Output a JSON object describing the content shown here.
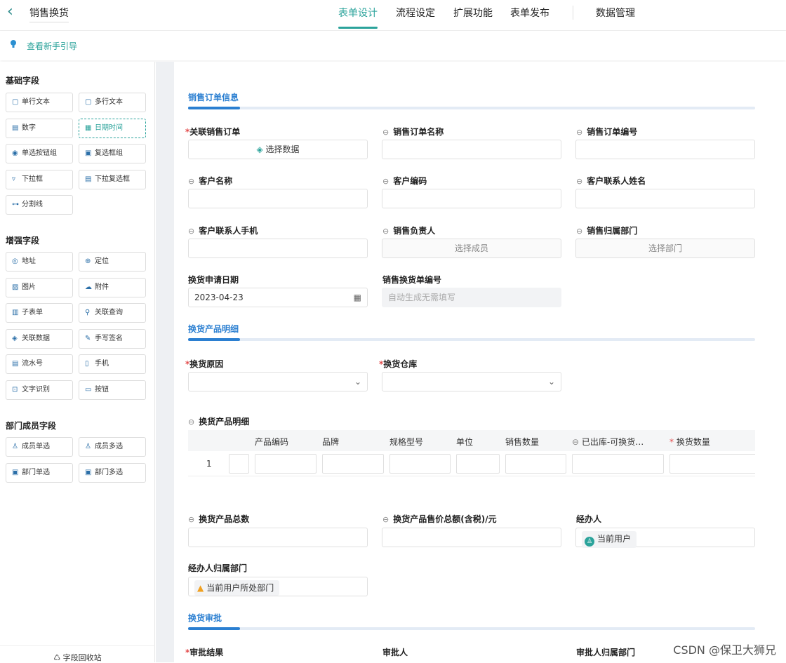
{
  "header": {
    "back_icon": "chevron-left-icon",
    "title": "销售换货",
    "tabs": [
      "表单设计",
      "流程设定",
      "扩展功能",
      "表单发布",
      "数据管理"
    ],
    "active_tab": "表单设计"
  },
  "guide": {
    "icon": "lightbulb-icon",
    "text": "查看新手引导"
  },
  "sidebar": {
    "basic_title": "基础字段",
    "basic": [
      {
        "label": "单行文本",
        "icon": "single-line-icon",
        "glyph": "▢"
      },
      {
        "label": "多行文本",
        "icon": "multi-line-icon",
        "glyph": "▢"
      },
      {
        "label": "数字",
        "icon": "number-icon",
        "glyph": "▤"
      },
      {
        "label": "日期时间",
        "icon": "calendar-icon",
        "glyph": "▦"
      },
      {
        "label": "单选按钮组",
        "icon": "radio-icon",
        "glyph": "◉"
      },
      {
        "label": "复选框组",
        "icon": "checkbox-icon",
        "glyph": "▣"
      },
      {
        "label": "下拉框",
        "icon": "dropdown-icon",
        "glyph": "▿"
      },
      {
        "label": "下拉复选框",
        "icon": "multi-dropdown-icon",
        "glyph": "▤"
      },
      {
        "label": "分割线",
        "icon": "divider-icon",
        "glyph": "⊶"
      }
    ],
    "advanced_title": "增强字段",
    "advanced": [
      {
        "label": "地址",
        "icon": "address-icon",
        "glyph": "◎"
      },
      {
        "label": "定位",
        "icon": "locate-icon",
        "glyph": "⊕"
      },
      {
        "label": "图片",
        "icon": "image-icon",
        "glyph": "▨"
      },
      {
        "label": "附件",
        "icon": "attachment-icon",
        "glyph": "☁"
      },
      {
        "label": "子表单",
        "icon": "subform-icon",
        "glyph": "▥"
      },
      {
        "label": "关联查询",
        "icon": "link-query-icon",
        "glyph": "⚲"
      },
      {
        "label": "关联数据",
        "icon": "link-data-icon",
        "glyph": "◈"
      },
      {
        "label": "手写签名",
        "icon": "signature-icon",
        "glyph": "✎"
      },
      {
        "label": "流水号",
        "icon": "serial-icon",
        "glyph": "▤"
      },
      {
        "label": "手机",
        "icon": "phone-icon",
        "glyph": "▯"
      },
      {
        "label": "文字识别",
        "icon": "ocr-icon",
        "glyph": "⊡"
      },
      {
        "label": "按钮",
        "icon": "button-icon",
        "glyph": "▭"
      }
    ],
    "member_title": "部门成员字段",
    "member": [
      {
        "label": "成员单选",
        "icon": "user-icon",
        "glyph": "♙"
      },
      {
        "label": "成员多选",
        "icon": "users-icon",
        "glyph": "♙"
      },
      {
        "label": "部门单选",
        "icon": "dept-icon",
        "glyph": "▣"
      },
      {
        "label": "部门多选",
        "icon": "depts-icon",
        "glyph": "▣"
      }
    ],
    "recycle": "字段回收站"
  },
  "form": {
    "g1": "销售订单信息",
    "f_link_order": "关联销售订单",
    "select_data": "选择数据",
    "f_order_name": "销售订单名称",
    "f_order_no": "销售订单编号",
    "f_cust_name": "客户名称",
    "f_cust_code": "客户编码",
    "f_contact": "客户联系人姓名",
    "f_contact_phone": "客户联系人手机",
    "f_owner": "销售负责人",
    "select_member": "选择成员",
    "f_dept": "销售归属部门",
    "select_dept": "选择部门",
    "f_apply_date": "换货申请日期",
    "apply_date": "2023-04-23",
    "f_exchange_no": "销售换货单编号",
    "auto_gen": "自动生成无需填写",
    "g2": "换货产品明细",
    "f_reason": "换货原因",
    "f_warehouse": "换货仓库",
    "f_detail": "换货产品明细",
    "table_headers": [
      "产品编码",
      "品牌",
      "规格型号",
      "单位",
      "销售数量",
      "已出库-可换货…",
      "换货数量"
    ],
    "row_num": "1",
    "f_total_qty": "换货产品总数",
    "f_total_amount": "换货产品售价总额(含税)/元",
    "f_handler": "经办人",
    "current_user": "当前用户",
    "f_handler_dept": "经办人归属部门",
    "current_dept": "当前用户所处部门",
    "g3": "换货审批",
    "f_result": "审批结果",
    "f_approver": "审批人",
    "f_approver_dept": "审批人归属部门"
  },
  "watermark": "CSDN @保卫大狮兄",
  "colors": {
    "accent": "#2ba39b",
    "blue": "#2b7fd1",
    "required": "#e34b4b"
  }
}
